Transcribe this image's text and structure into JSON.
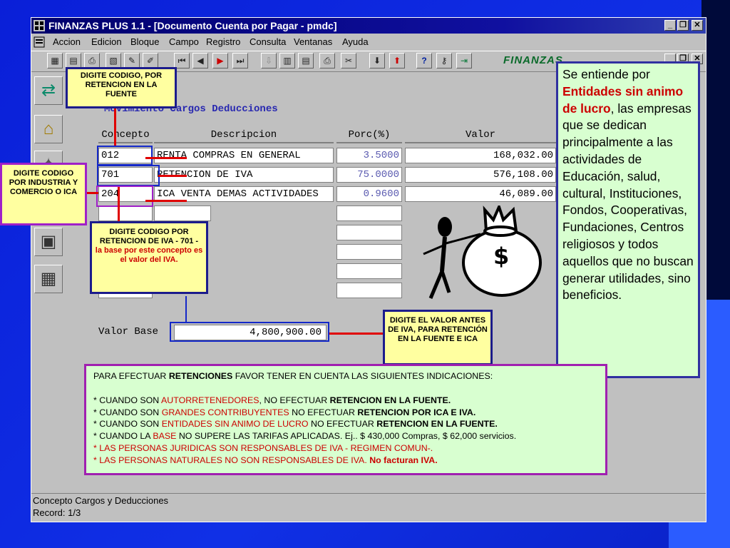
{
  "window": {
    "title": "FINANZAS PLUS 1.1 - [Documento Cuenta por Pagar - pmdc]",
    "logo": "FINANZAS"
  },
  "menu": [
    "Accion",
    "Edicion",
    "Bloque",
    "Campo",
    "Registro",
    "Consulta",
    "Ventanas",
    "Ayuda"
  ],
  "toolbar_icons": [
    "save-icon",
    "edit-icon",
    "print-icon",
    "copy-icon",
    "clear-icon",
    "first-icon",
    "prev-icon",
    "next-icon",
    "last-icon",
    "insert-icon",
    "query-icon",
    "list-icon",
    "printer-icon",
    "tools-icon",
    "download-icon",
    "upload-icon",
    "help-icon",
    "key-icon",
    "exit-icon"
  ],
  "form": {
    "title": "Movimiento Cargos Deducciones",
    "columns": [
      "Concepto",
      "Descripcion",
      "Porc(%)",
      "Valor"
    ],
    "rows": [
      {
        "concepto": "012",
        "descripcion": "RENTA COMPRAS EN GENERAL",
        "porc": "3.5000",
        "valor": "168,032.00"
      },
      {
        "concepto": "701",
        "descripcion": "RETENCION DE IVA",
        "porc": "75.0000",
        "valor": "576,108.00"
      },
      {
        "concepto": "204",
        "descripcion": "ICA VENTA DEMAS ACTIVIDADES",
        "porc": "0.9600",
        "valor": "46,089.00"
      }
    ],
    "base_label": "Valor Base",
    "base_value": "4,800,900.00"
  },
  "status": {
    "line1": "Concepto Cargos y Deducciones",
    "line2": "Record: 1/3"
  },
  "callouts": {
    "retencion_fuente": "DIGITE CODIGO, POR RETENCION EN LA FUENTE",
    "ica": "DIGITE CODIGO POR INDUSTRIA Y COMERCIO O ICA",
    "iva_title": "DIGITE CODIGO POR RETENCION DE IVA - 701 -",
    "iva_note": "la base por este concepto es el valor del IVA.",
    "valor_base": "DIGITE EL VALOR ANTES DE IVA, PARA RETENCIÓN EN LA FUENTE E ICA"
  },
  "side_panel": {
    "p1": "Se entiende por",
    "em": "Entidades sin animo de lucro",
    "p2": ", las empresas que se dedican principalmente a las actividades de Educación, salud, cultural, Instituciones, Fondos, Cooperativas, Fundaciones, Centros religiosos y todos aquellos que no buscan generar utilidades, sino beneficios."
  },
  "info": {
    "intro_a": "PARA EFECTUAR ",
    "intro_b": "RETENCIONES",
    "intro_c": " FAVOR TENER EN CUENTA LAS SIGUIENTES INDICACIONES:",
    "l1_a": "* CUANDO SON ",
    "l1_r": "AUTORRETENEDORES",
    "l1_b": ", NO EFECTUAR ",
    "l1_bold": "RETENCION EN LA FUENTE.",
    "l2_a": "* CUANDO SON ",
    "l2_r": "GRANDES CONTRIBUYENTES",
    "l2_b": " NO EFECTUAR ",
    "l2_bold": "RETENCION POR ICA E IVA.",
    "l3_a": "* CUANDO SON ",
    "l3_r": "ENTIDADES SIN ANIMO DE LUCRO",
    "l3_b": " NO EFECTUAR ",
    "l3_bold": "RETENCION EN LA FUENTE.",
    "l4_a": "* CUANDO LA ",
    "l4_r": "BASE",
    "l4_b": " NO SUPERE LAS TARIFAS APLICADAS. Ej..  $ 430,000 Compras, $ 62,000 servicios.",
    "l5_r": "* LAS PERSONAS JURIDICAS SON RESPONSABLES DE IVA - REGIMEN COMUN-.",
    "l6_r": "* LAS PERSONAS NATURALES NO SON RESPONSABLES DE IVA. ",
    "l6_bold": "No facturan IVA."
  },
  "money_symbol": "$"
}
